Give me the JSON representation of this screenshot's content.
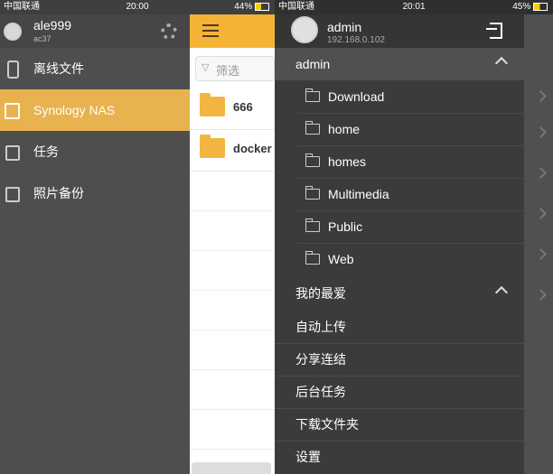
{
  "left_screen": {
    "status": {
      "carrier": "中国联通",
      "time": "20:00",
      "battery": "44%"
    },
    "account": {
      "username": "ale999",
      "host": "ac37"
    },
    "menu": [
      {
        "label": "离线文件",
        "icon": "phone-icon"
      },
      {
        "label": "Synology NAS",
        "icon": "nas-icon",
        "active": true
      },
      {
        "label": "任务",
        "icon": "task-icon"
      },
      {
        "label": "照片备份",
        "icon": "photo-backup-icon"
      }
    ],
    "filter_placeholder": "筛选",
    "folders": [
      {
        "name": "666"
      },
      {
        "name": "docker"
      }
    ]
  },
  "right_screen": {
    "status": {
      "carrier": "中国联通",
      "time": "20:01",
      "battery": "45%"
    },
    "account": {
      "username": "admin",
      "ip": "192.168.0.102"
    },
    "sections": {
      "admin": {
        "label": "admin",
        "folders": [
          "Download",
          "home",
          "homes",
          "Multimedia",
          "Public",
          "Web"
        ]
      },
      "favorites": {
        "label": "我的最爱"
      }
    },
    "items": [
      "自动上传",
      "分享连结",
      "后台任务",
      "下载文件夹",
      "设置"
    ]
  },
  "colors": {
    "accent": "#f5b335",
    "active_item": "#e8b24e",
    "drawer_dark": "#3b3b3b"
  }
}
